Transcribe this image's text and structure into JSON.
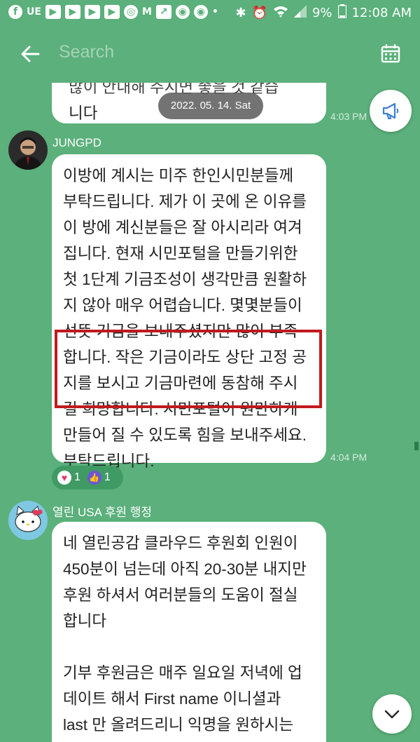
{
  "status_bar": {
    "battery": "9%",
    "time": "12:08 AM",
    "notification_icons": [
      "facebook-icon",
      "ue-icon",
      "youtube-icon",
      "youtube-icon",
      "youtube-icon",
      "youtube-icon",
      "target-icon",
      "gmail-icon",
      "chart-icon",
      "chrome-icon",
      "chrome-icon",
      "more-icon"
    ]
  },
  "header": {
    "search_placeholder": "Search"
  },
  "chat": {
    "date_pill": "2022. 05. 14. Sat",
    "prev_message": {
      "text_partial": "많이 안내해 주시면 좋을 것 같습",
      "text_end": "니다",
      "time": "4:03 PM"
    },
    "message1": {
      "sender": "JUNGPD",
      "text": "이방에 계시는 미주 한인시민분들께\n부탁드립니다. 제가 이 곳에 온 이유를\n이 방에 계신분들은 잘 아시리라 여겨\n집니다. 현재 시민포털을 만들기위한\n첫 1단계 기금조성이 생각만큼 원활하\n지 않아 매우 어렵습니다. 몇몇분들이\n선뜻 기금을 보내주셨지만 많이 부족\n합니다. 작은 기금이라도 상단 고정 공\n지를 보시고 기금마련에 동참해 주시\n길 희망합니다.  시민포털이 원만하게\n만들어 질 수 있도록 힘을 보내주세요.\n부탁드립니다.",
      "time": "4:04 PM",
      "reactions": {
        "heart": "1",
        "like": "1"
      }
    },
    "message2": {
      "sender": "열린 USA 후원 행정",
      "text": "네 열린공감 클라우드 후원회 인원이\n450분이 넘는데 아직 20-30분 내지만\n후원 하셔서 여러분들의 도움이 절실\n합니다\n\n기부 후원금은 매주 일요일 저녁에 업\n데이트 해서 First name 이니셜과\nlast 만 올려드리니 익명을 원하시는\n분들도 본인만 알수 있도록 업데이트"
    }
  },
  "colors": {
    "background": "#5bb07b",
    "highlight_border": "#c0191f",
    "bubble": "#ffffff"
  }
}
